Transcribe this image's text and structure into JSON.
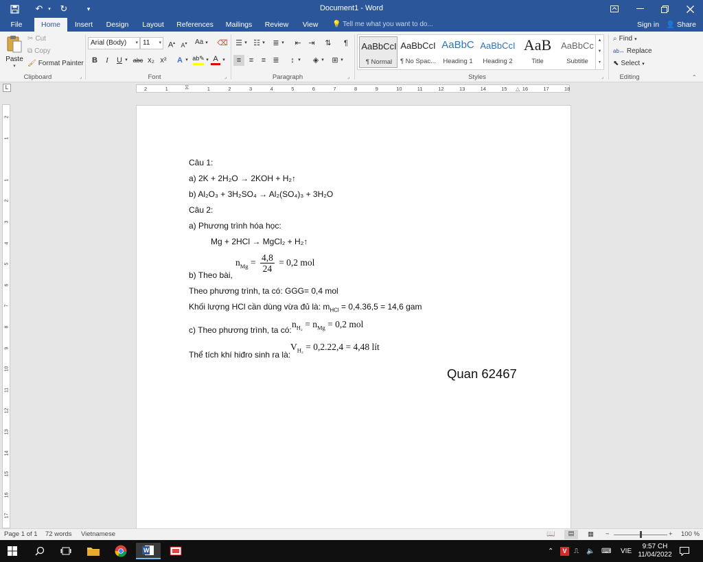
{
  "window": {
    "title": "Document1 - Word",
    "qa_icons": [
      "save-icon",
      "undo-icon",
      "redo-icon",
      "customize-icon"
    ],
    "controls": [
      "ribbon-display-icon",
      "minimize-icon",
      "restore-icon",
      "close-icon"
    ]
  },
  "tabs": [
    {
      "label": "File"
    },
    {
      "label": "Home"
    },
    {
      "label": "Insert"
    },
    {
      "label": "Design"
    },
    {
      "label": "Layout"
    },
    {
      "label": "References"
    },
    {
      "label": "Mailings"
    },
    {
      "label": "Review"
    },
    {
      "label": "View"
    }
  ],
  "tell_me": "Tell me what you want to do...",
  "sign_in": "Sign in",
  "share": "Share",
  "clipboard": {
    "paste": "Paste",
    "cut": "Cut",
    "copy": "Copy",
    "format_painter": "Format Painter",
    "label": "Clipboard"
  },
  "font": {
    "name": "Arial (Body)",
    "size": "11",
    "label": "Font",
    "case_label": "Aa",
    "bold": "B",
    "italic": "I",
    "underline": "U",
    "strike": "abc",
    "subscript": "x₂",
    "superscript": "x²",
    "highlight_color": "#ffff00",
    "font_color": "#e00000"
  },
  "paragraph": {
    "label": "Paragraph"
  },
  "styles": {
    "label": "Styles",
    "items": [
      {
        "sample": "AaBbCcI",
        "name": "¶ Normal"
      },
      {
        "sample": "AaBbCcI",
        "name": "¶ No Spac..."
      },
      {
        "sample": "AaBbC",
        "name": "Heading 1"
      },
      {
        "sample": "AaBbCcI",
        "name": "Heading 2"
      },
      {
        "sample": "AaB",
        "name": "Title"
      },
      {
        "sample": "AaBbCc",
        "name": "Subtitle"
      }
    ]
  },
  "editing": {
    "find": "Find",
    "replace": "Replace",
    "select": "Select",
    "label": "Editing"
  },
  "ruler": {
    "h_ticks": [
      "2",
      "1",
      "1",
      "2",
      "3",
      "4",
      "5",
      "6",
      "7",
      "8",
      "9",
      "10",
      "11",
      "12",
      "13",
      "14",
      "15",
      "16",
      "17",
      "18"
    ],
    "v_ticks": [
      "2",
      "1",
      "1",
      "2",
      "3",
      "4",
      "5",
      "6",
      "7",
      "8",
      "9",
      "10",
      "11",
      "12",
      "13",
      "14",
      "15",
      "16",
      "17"
    ],
    "corner": "L"
  },
  "document": {
    "cau1": "Câu 1:",
    "eq_a": "a) 2K + 2H₂O → 2KOH + H₂↑",
    "eq_b": "b) Al₂O₃ + 3H₂SO₄ → Al₂(SO₄)₃ + 3H₂O",
    "cau2": "Câu 2:",
    "part_a": "a)  Phương trình hóa học:",
    "reaction": "Mg + 2HCl → MgCl₂ + H₂↑",
    "part_b_prefix": "b) Theo bài,",
    "nmg_n": "n",
    "nmg_sub": "Mg",
    "nmg_eq": "=",
    "nmg_num": "4,8",
    "nmg_den": "24",
    "nmg_res": "= 0,2 mol",
    "theo_pt": "Theo phương trình, ta có: GGG= 0,4 mol",
    "hcl_prefix": "Khối lượng HCl cần dùng vừa đủ là: m",
    "hcl_sub": "HCl",
    "hcl_rest": " = 0,4.36,5 = 14,6 gam",
    "part_c_prefix": "c) Theo phương trình, ta có:",
    "nh2_n": "n",
    "nh2_sub": "H₂",
    "nh2_mid": " = n",
    "nh2_sub2": "Mg",
    "nh2_res": " = 0,2 mol",
    "vol_prefix": "Thể tích khí hiđro sinh ra là:",
    "vol_v": "V",
    "vol_sub": "H₂",
    "vol_res": " = 0,2.22,4 = 4,48 lít",
    "signature": "Quan 62467"
  },
  "status": {
    "page": "Page 1 of 1",
    "words": "72 words",
    "language": "Vietnamese",
    "zoom_minus": "−",
    "zoom_plus": "+",
    "zoom": "100 %",
    "zoom_level": 0.5
  },
  "taskbar": {
    "lang": "VIE",
    "time": "9:57 CH",
    "date": "11/04/2022"
  }
}
